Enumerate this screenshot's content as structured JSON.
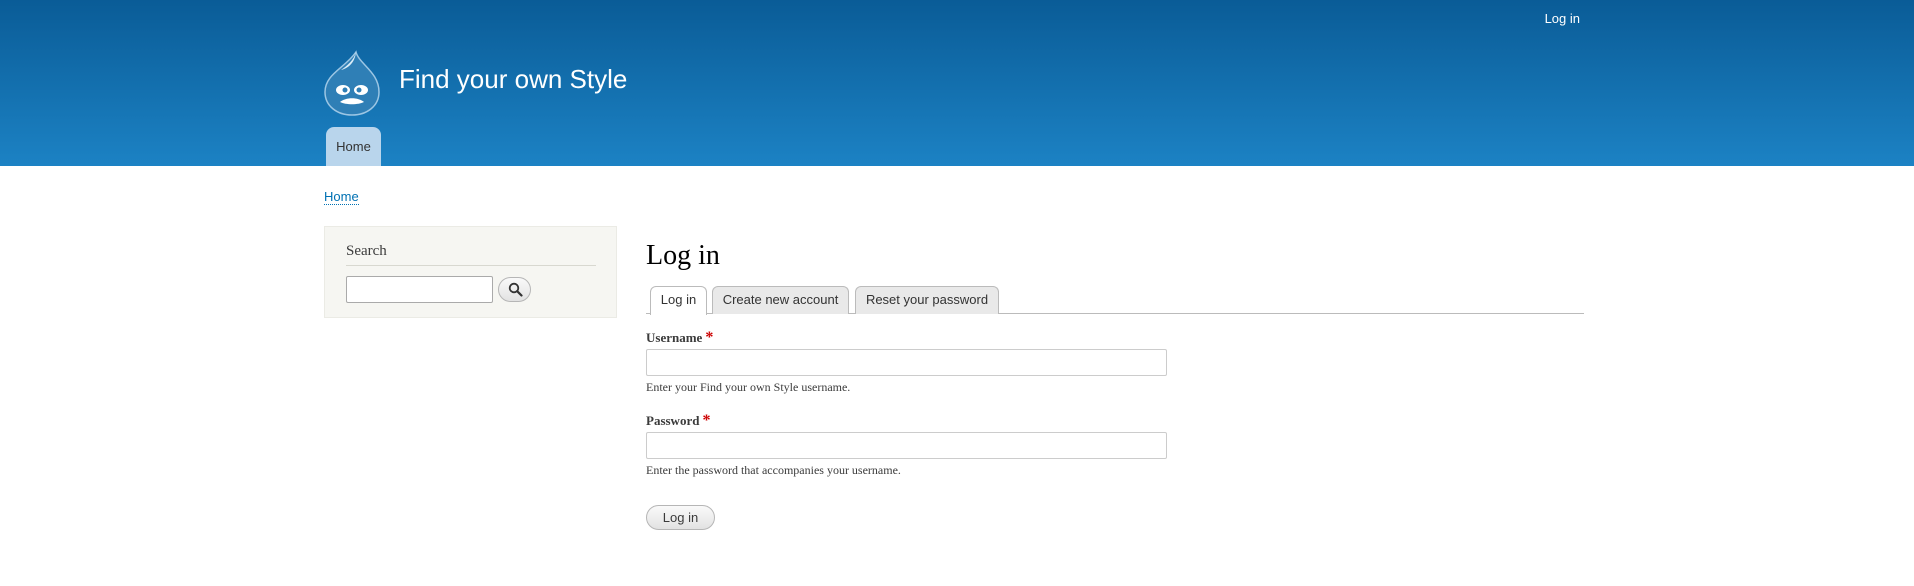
{
  "header": {
    "secondary_menu_login": "Log in",
    "site_name": "Find your own Style",
    "main_menu": [
      {
        "label": "Home",
        "active": true
      }
    ],
    "colors": {
      "gradient_top": "#0a5c97",
      "gradient_bottom": "#1c82c4"
    }
  },
  "breadcrumb": {
    "home": "Home"
  },
  "sidebar": {
    "search": {
      "title": "Search",
      "input_value": "",
      "button_icon": "search-icon"
    }
  },
  "main": {
    "title": "Log in",
    "tabs": [
      {
        "label": "Log in",
        "active": true
      },
      {
        "label": "Create new account",
        "active": false
      },
      {
        "label": "Reset your password",
        "active": false
      }
    ],
    "username": {
      "label": "Username",
      "required_marker": "*",
      "value": "",
      "description": "Enter your Find your own Style username."
    },
    "password": {
      "label": "Password",
      "required_marker": "*",
      "value": "",
      "description": "Enter the password that accompanies your username."
    },
    "submit_label": "Log in"
  }
}
